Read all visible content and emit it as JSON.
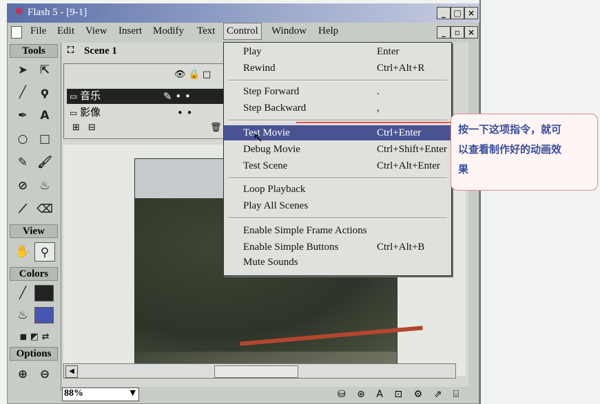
{
  "window": {
    "title": "Flash 5 - [9-1]",
    "caption_buttons": [
      "_",
      "□",
      "×"
    ],
    "doc_buttons": [
      "_",
      "▫",
      "×"
    ]
  },
  "menubar": {
    "items": [
      "File",
      "Edit",
      "View",
      "Insert",
      "Modify",
      "Text",
      "Control",
      "Window",
      "Help"
    ]
  },
  "scene": {
    "label": "Scene 1"
  },
  "timeline": {
    "layers": [
      "音乐",
      "影像"
    ]
  },
  "tools": {
    "tools_label": "Tools",
    "view_label": "View",
    "colors_label": "Colors",
    "options_label": "Options"
  },
  "control_menu": {
    "items": [
      {
        "label": "Play",
        "shortcut": "Enter"
      },
      {
        "label": "Rewind",
        "shortcut": "Ctrl+Alt+R"
      },
      {
        "label": "Step Forward",
        "shortcut": "."
      },
      {
        "label": "Step Backward",
        "shortcut": ","
      },
      {
        "label": "Test Movie",
        "shortcut": "Ctrl+Enter"
      },
      {
        "label": "Debug Movie",
        "shortcut": "Ctrl+Shift+Enter"
      },
      {
        "label": "Test Scene",
        "shortcut": "Ctrl+Alt+Enter"
      },
      {
        "label": "Loop Playback",
        "shortcut": ""
      },
      {
        "label": "Play All Scenes",
        "shortcut": ""
      },
      {
        "label": "Enable Simple Frame Actions",
        "shortcut": ""
      },
      {
        "label": "Enable Simple Buttons",
        "shortcut": "Ctrl+Alt+B"
      },
      {
        "label": "Mute Sounds",
        "shortcut": ""
      }
    ]
  },
  "statusbar": {
    "zoom": "88%"
  },
  "callout": {
    "line1": "按一下这项指令，就可",
    "line2": "以查看制作好的动画效",
    "line3": "果"
  },
  "colors": {
    "highlight": "#4a5392",
    "callout_text": "#3b4d9a",
    "callout_border": "#d88a8a"
  }
}
